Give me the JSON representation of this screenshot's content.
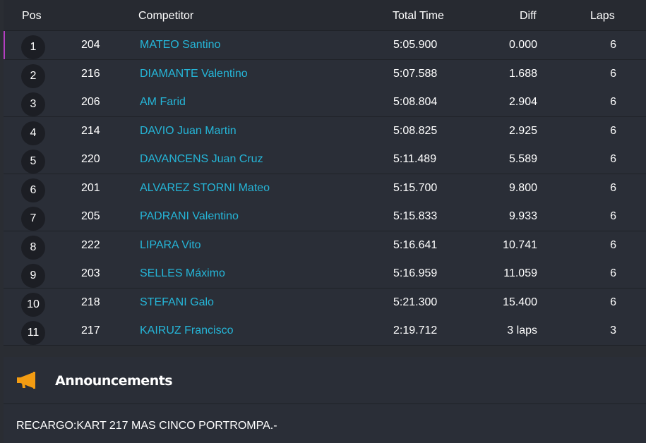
{
  "headers": {
    "pos": "Pos",
    "competitor": "Competitor",
    "total_time": "Total Time",
    "diff": "Diff",
    "laps": "Laps"
  },
  "rows": [
    {
      "pos": "1",
      "number": "204",
      "name": "MATEO Santino",
      "time": "5:05.900",
      "diff": "0.000",
      "laps": "6"
    },
    {
      "pos": "2",
      "number": "216",
      "name": "DIAMANTE Valentino",
      "time": "5:07.588",
      "diff": "1.688",
      "laps": "6"
    },
    {
      "pos": "3",
      "number": "206",
      "name": "AM Farid",
      "time": "5:08.804",
      "diff": "2.904",
      "laps": "6"
    },
    {
      "pos": "4",
      "number": "214",
      "name": "DAVIO Juan Martin",
      "time": "5:08.825",
      "diff": "2.925",
      "laps": "6"
    },
    {
      "pos": "5",
      "number": "220",
      "name": "DAVANCENS Juan Cruz",
      "time": "5:11.489",
      "diff": "5.589",
      "laps": "6"
    },
    {
      "pos": "6",
      "number": "201",
      "name": "ALVAREZ STORNI Mateo",
      "time": "5:15.700",
      "diff": "9.800",
      "laps": "6"
    },
    {
      "pos": "7",
      "number": "205",
      "name": "PADRANI Valentino",
      "time": "5:15.833",
      "diff": "9.933",
      "laps": "6"
    },
    {
      "pos": "8",
      "number": "222",
      "name": "LIPARA Vito",
      "time": "5:16.641",
      "diff": "10.741",
      "laps": "6"
    },
    {
      "pos": "9",
      "number": "203",
      "name": "SELLES Máximo",
      "time": "5:16.959",
      "diff": "11.059",
      "laps": "6"
    },
    {
      "pos": "10",
      "number": "218",
      "name": "STEFANI Galo",
      "time": "5:21.300",
      "diff": "15.400",
      "laps": "6"
    },
    {
      "pos": "11",
      "number": "217",
      "name": "KAIRUZ Francisco",
      "time": "2:19.712",
      "diff": "3 laps",
      "laps": "3"
    }
  ],
  "announcements": {
    "icon": "megaphone-icon",
    "title": "Announcements",
    "text": "RECARGO:KART 217 MAS CINCO PORTROMPA.-"
  },
  "colors": {
    "competitor_link": "#25b6d8",
    "leader_marker": "#b43ec2",
    "megaphone": "#f39c12"
  }
}
